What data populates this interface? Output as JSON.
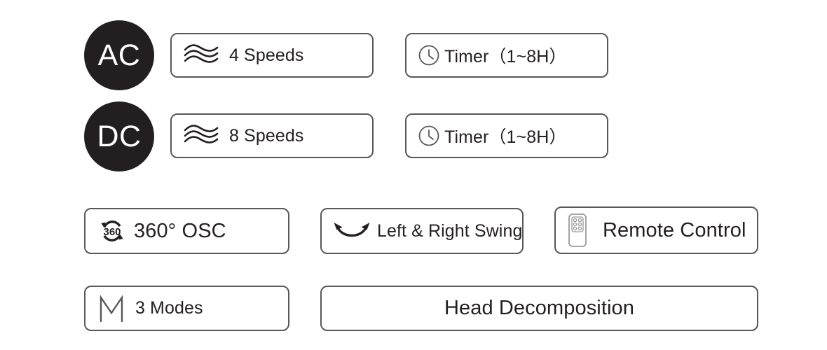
{
  "meta": {
    "background_color": "#ffffff",
    "text_color": "#231f20",
    "border_color": "#58585a",
    "badge_fill": "#231f20",
    "badge_text_color": "#ffffff"
  },
  "badges": [
    {
      "id": "ac",
      "label": "AC"
    },
    {
      "id": "dc",
      "label": "DC"
    }
  ],
  "features": {
    "ac_speeds": {
      "icon": "wave-speed-icon",
      "label": "4 Speeds"
    },
    "ac_timer": {
      "icon": "clock-icon",
      "label": "Timer（1~8H）"
    },
    "dc_speeds": {
      "icon": "wave-speed-icon",
      "label": "8 Speeds"
    },
    "dc_timer": {
      "icon": "clock-icon",
      "label": "Timer（1~8H）"
    },
    "osc": {
      "icon": "360-rotation-icon",
      "label": "360° OSC",
      "icon_text": "360"
    },
    "swing": {
      "icon": "left-right-swing-icon",
      "label": "Left & Right Swing"
    },
    "remote": {
      "icon": "remote-control-icon",
      "label": "Remote Control"
    },
    "modes": {
      "icon": "mode-m-icon",
      "label": "3 Modes",
      "icon_text": "M"
    },
    "head": {
      "icon": "none",
      "label": "Head Decomposition"
    }
  }
}
